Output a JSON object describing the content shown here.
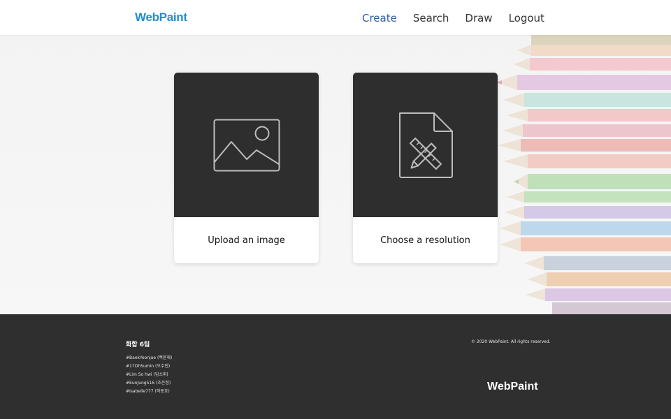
{
  "header": {
    "logo": "WebPaint",
    "nav": [
      {
        "label": "Create",
        "active": true
      },
      {
        "label": "Search"
      },
      {
        "label": "Draw"
      },
      {
        "label": "Logout"
      }
    ]
  },
  "cards": [
    {
      "label": "Upload an image",
      "icon": "image-icon"
    },
    {
      "label": "Choose a resolution",
      "icon": "document-ruler-pencil-icon"
    }
  ],
  "footer": {
    "team": "화합 6팀",
    "members": [
      "#BaekYoonjae (백윤재)",
      "#17OhSumin (오수민)",
      "#Lim So hwi (임소휘)",
      "#EunJung516 (조은정)",
      "#Isabelle777 (허동호)"
    ],
    "copyright": "© 2020 WebPaint. All rights reserved.",
    "logo": "WebPaint"
  },
  "colors": {
    "brand": "#1e8fd6",
    "nav_active": "#2e5ea8",
    "card_dark": "#2e2e2e",
    "footer_bg": "#2f2f2f"
  }
}
